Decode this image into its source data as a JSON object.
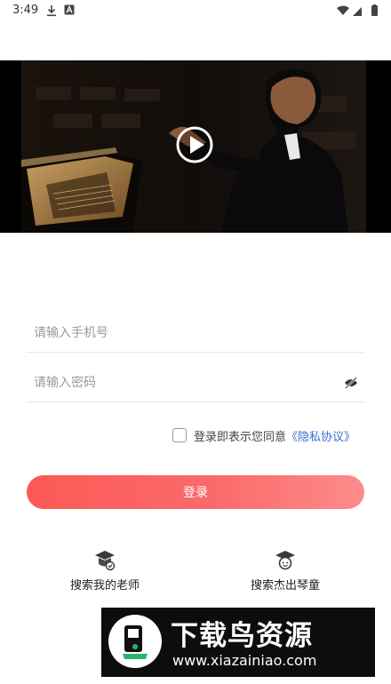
{
  "status_bar": {
    "time": "3:49"
  },
  "video": {
    "play_icon": "play-circle-icon"
  },
  "login": {
    "phone_placeholder": "请输入手机号",
    "password_placeholder": "请输入密码",
    "eye_icon": "eye-off-icon",
    "agree_text": "登录即表示您同意",
    "privacy_link": "《隐私协议》",
    "submit_label": "登录"
  },
  "shortcuts": [
    {
      "label": "搜索我的老师",
      "icon": "teacher-graduation-cap-icon"
    },
    {
      "label": "搜索杰出琴童",
      "icon": "student-graduation-cap-icon"
    }
  ],
  "watermark": {
    "brand_cn": "下载鸟资源",
    "url": "www.xiazainiao.com"
  },
  "colors": {
    "accent_start": "#fb5a55",
    "accent_end": "#fd8b8b",
    "link": "#3b6fd6"
  }
}
